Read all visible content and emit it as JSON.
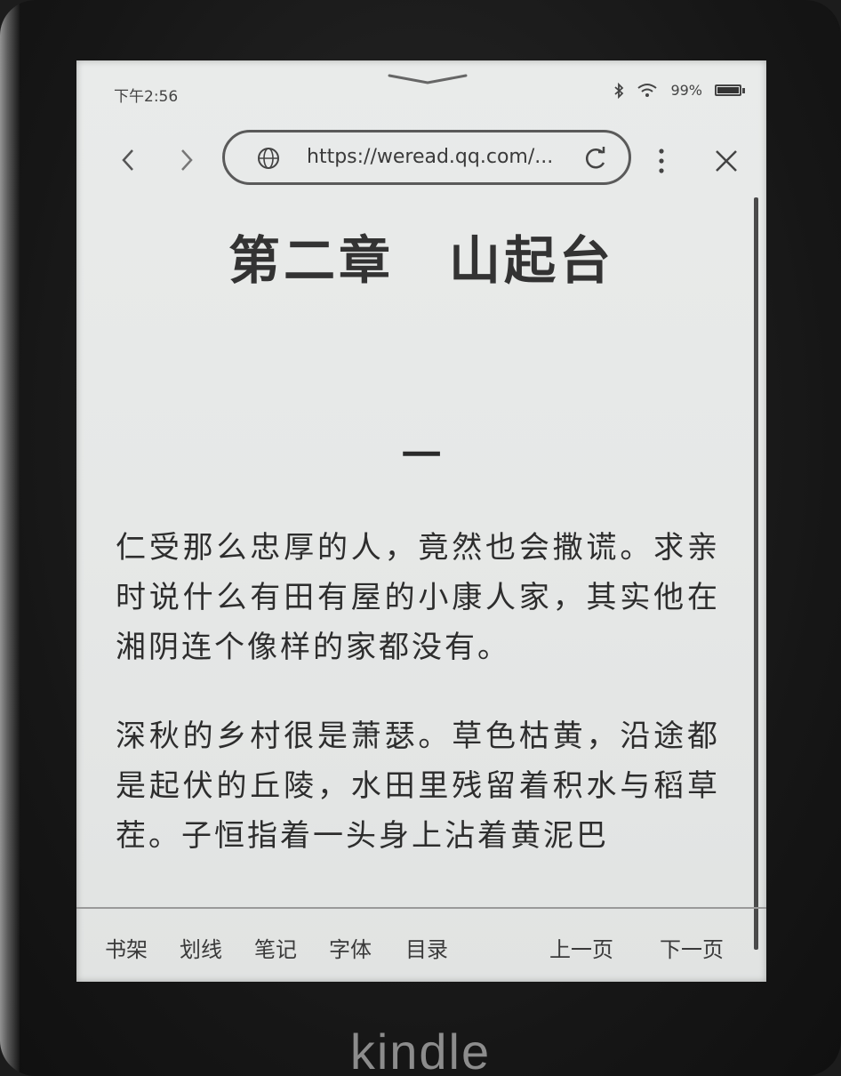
{
  "status": {
    "time": "下午2:56",
    "battery": "99%",
    "battery_level": 0.99
  },
  "browser": {
    "url": "https://weread.qq.com/...",
    "icons": {
      "back": "chevron-left-icon",
      "forward": "chevron-right-icon",
      "site": "globe-icon",
      "reload": "reload-icon",
      "more": "more-vertical-icon",
      "close": "close-icon"
    }
  },
  "chapter": {
    "title": "第二章　山起台",
    "section": "一"
  },
  "paragraphs": [
    "仁受那么忠厚的人，竟然也会撒谎。求亲时说什么有田有屋的小康人家，其实他在湘阴连个像样的家都没有。",
    "深秋的乡村很是萧瑟。草色枯黄，沿途都是起伏的丘陵，水田里残留着积水与稻草茬。子恒指着一头身上沾着黄泥巴"
  ],
  "bottom_nav": {
    "bookshelf": "书架",
    "highlight": "划线",
    "notes": "笔记",
    "font": "字体",
    "toc": "目录",
    "prev_page": "上一页",
    "next_page": "下一页"
  },
  "device": {
    "brand": "kindle"
  },
  "colors": {
    "screen_bg": "#e6e8e7",
    "text": "#2d2d2d",
    "bezel": "#161616"
  }
}
